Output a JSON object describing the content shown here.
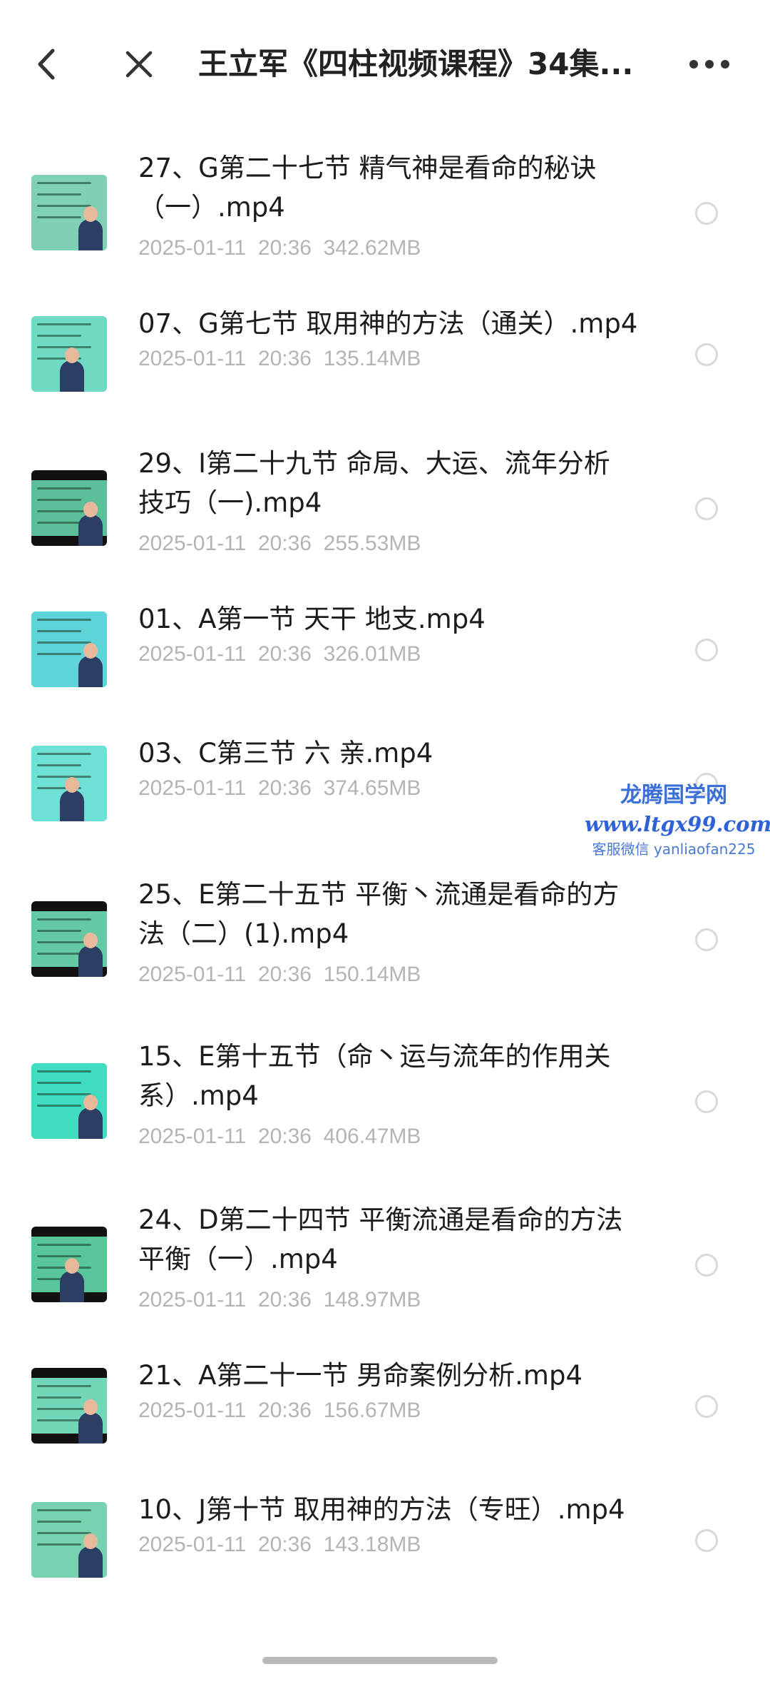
{
  "header": {
    "title": "王立军《四柱视频课程》34集...",
    "back_icon": "chevron-left-icon",
    "close_icon": "close-icon",
    "more_icon": "more-horizontal-icon"
  },
  "files": [
    {
      "name_line1": "27、G第二十七节  精气神是看命的秘诀",
      "name_line2": "（一）.mp4",
      "date": "2025-01-11",
      "time": "20:36",
      "size": "342.62MB"
    },
    {
      "name_line1": "07、G第七节 取用神的方法（通关）.mp4",
      "name_line2": "",
      "date": "2025-01-11",
      "time": "20:36",
      "size": "135.14MB"
    },
    {
      "name_line1": "29、I第二十九节  命局、大运、流年分析",
      "name_line2": "技巧（一).mp4",
      "date": "2025-01-11",
      "time": "20:36",
      "size": "255.53MB"
    },
    {
      "name_line1": "01、A第一节 天干 地支.mp4",
      "name_line2": "",
      "date": "2025-01-11",
      "time": "20:36",
      "size": "326.01MB"
    },
    {
      "name_line1": "03、C第三节 六 亲.mp4",
      "name_line2": "",
      "date": "2025-01-11",
      "time": "20:36",
      "size": "374.65MB"
    },
    {
      "name_line1": "25、E第二十五节  平衡丶流通是看命的方",
      "name_line2": "法（二）(1).mp4",
      "date": "2025-01-11",
      "time": "20:36",
      "size": "150.14MB"
    },
    {
      "name_line1": "15、E第十五节（命丶运与流年的作用关",
      "name_line2": "系）.mp4",
      "date": "2025-01-11",
      "time": "20:36",
      "size": "406.47MB"
    },
    {
      "name_line1": "24、D第二十四节  平衡流通是看命的方法",
      "name_line2": "平衡（一）.mp4",
      "date": "2025-01-11",
      "time": "20:36",
      "size": "148.97MB"
    },
    {
      "name_line1": "21、A第二十一节  男命案例分析.mp4",
      "name_line2": "",
      "date": "2025-01-11",
      "time": "20:36",
      "size": "156.67MB"
    },
    {
      "name_line1": "10、J第十节 取用神的方法（专旺）.mp4",
      "name_line2": "",
      "date": "2025-01-11",
      "time": "20:36",
      "size": "143.18MB"
    }
  ],
  "watermark": {
    "line1": "龙腾国学网",
    "line2": "www.ltgx99.com",
    "line3": "客服微信 yanliaofan225"
  },
  "colors": {
    "text_primary": "#1c1c1c",
    "text_secondary": "#b4b4b4",
    "radio_border": "#d9d9d9",
    "watermark": "#3a6fd8"
  }
}
